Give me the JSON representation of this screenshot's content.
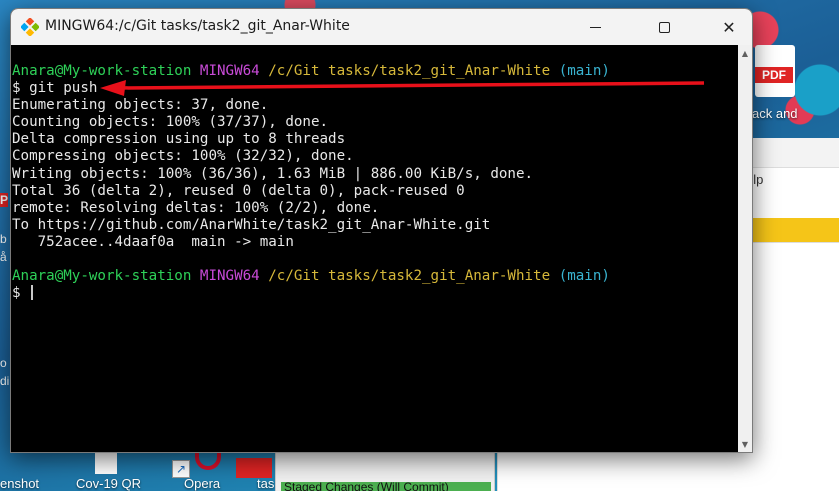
{
  "window": {
    "title": "MINGW64:/c/Git tasks/task2_git_Anar-White",
    "buttons": {
      "minimize_icon": "minimize-icon",
      "maximize_icon": "maximize-icon",
      "close_icon": "close-icon",
      "close_glyph": "✕"
    }
  },
  "terminal": {
    "prompt1": {
      "user_host": "Anara@My-work-station",
      "shell": "MINGW64",
      "path": "/c/Git tasks/task2_git_Anar-White",
      "branch": "(main)"
    },
    "command": "$ git push",
    "output": [
      "Enumerating objects: 37, done.",
      "Counting objects: 100% (37/37), done.",
      "Delta compression using up to 8 threads",
      "Compressing objects: 100% (32/32), done.",
      "Writing objects: 100% (36/36), 1.63 MiB | 886.00 KiB/s, done.",
      "Total 36 (delta 2), reused 0 (delta 0), pack-reused 0",
      "remote: Resolving deltas: 100% (2/2), done.",
      "To https://github.com/AnarWhite/task2_git_Anar-White.git",
      "   752acee..4daaf0a  main -> main"
    ],
    "prompt2": {
      "user_host": "Anara@My-work-station",
      "shell": "MINGW64",
      "path": "/c/Git tasks/task2_git_Anar-White",
      "branch": "(main)"
    },
    "input_prompt": "$"
  },
  "desktop": {
    "pdf_badge": "PDF",
    "pdf_label": "ack and",
    "help_text": "elp",
    "bottom_labels": [
      "enshot",
      "Cov-19 QR",
      "Opera",
      "tas",
      "Staged Changes (Will Commit)"
    ],
    "left_letters": [
      "b",
      "å",
      "P",
      "o",
      "di"
    ]
  },
  "colors": {
    "prompt_user": "#2ed158",
    "prompt_shell": "#c94bd8",
    "prompt_path": "#d6b83a",
    "prompt_branch": "#39b3d0",
    "annotation_arrow": "#e8101a"
  }
}
